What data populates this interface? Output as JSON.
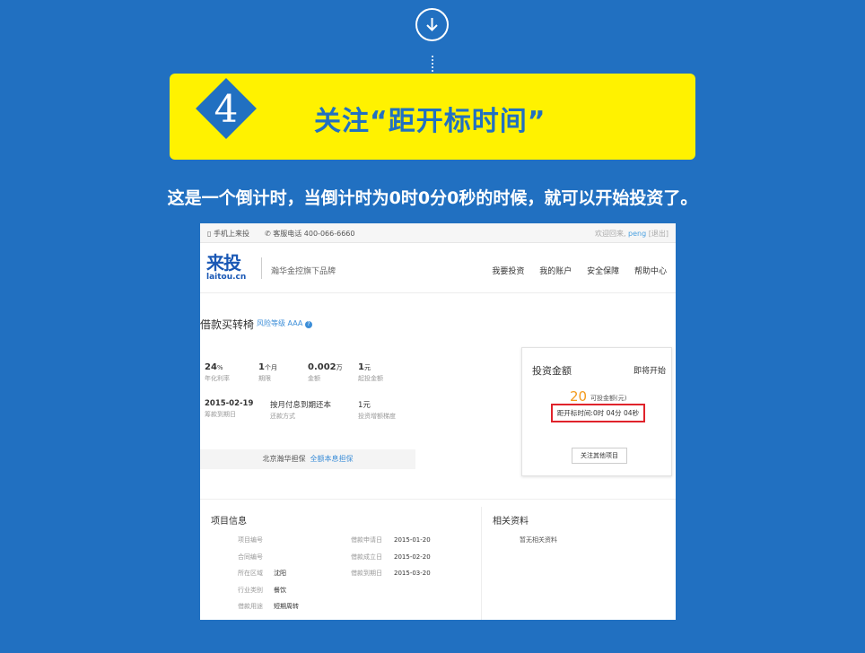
{
  "step": {
    "number": "4",
    "title": "关注“距开标时间”"
  },
  "subtitle": "这是一个倒计时，当倒计时为0时0分0秒的时候，就可以开始投资了。",
  "screenshot": {
    "topbar": {
      "mobile": "手机上来投",
      "hotline": "客服电话 400-066-6660",
      "welcome": "欢迎回来,",
      "username": "peng",
      "logout": "[退出]"
    },
    "logo": {
      "cn": "来投",
      "en": "laitou.cn"
    },
    "slogan": "瀚华金控旗下品牌",
    "nav": [
      "我要投资",
      "我的账户",
      "安全保障",
      "帮助中心"
    ],
    "loan": {
      "title": "借款买转椅",
      "risk_label": "风险等级 AAA",
      "metrics": [
        {
          "value": "24",
          "unit": "%",
          "label": "年化利率"
        },
        {
          "value": "1",
          "unit": "个月",
          "label": "期限"
        },
        {
          "value": "0.002",
          "unit": "万",
          "label": "金额"
        },
        {
          "value": "1",
          "unit": "元",
          "label": "起投金额"
        },
        {
          "value": "2015-02-19",
          "unit": "",
          "label": "筹款到期日"
        },
        {
          "value": "按月付息到期还本",
          "unit": "",
          "label": "还款方式"
        },
        {
          "value": "1",
          "unit": "元",
          "label": "投资增额梯度"
        }
      ],
      "guarantee_org": "北京瀚华担保",
      "guarantee_type": "全额本息担保"
    },
    "invest_box": {
      "title": "投资金额",
      "status": "即将开始",
      "amount": "20",
      "amount_label": "可投金额(元)",
      "countdown": "距开标时间:0时 04分 04秒",
      "follow_button": "关注其他项目"
    },
    "project_info": {
      "title": "项目信息",
      "left_fields": [
        {
          "key": "项目编号",
          "value": ""
        },
        {
          "key": "合同编号",
          "value": ""
        },
        {
          "key": "所在区域",
          "value": "沈阳"
        },
        {
          "key": "行业类别",
          "value": "餐饮"
        },
        {
          "key": "借款用途",
          "value": "短期周转"
        }
      ],
      "right_fields": [
        {
          "key": "借款申请日",
          "value": "2015-01-20"
        },
        {
          "key": "借款成立日",
          "value": "2015-02-20"
        },
        {
          "key": "借款到期日",
          "value": "2015-03-20"
        }
      ]
    },
    "related": {
      "title": "相关资料",
      "empty": "暂无相关资料"
    }
  },
  "colors": {
    "background": "#2170c1",
    "banner": "#fff200",
    "highlight_border": "#e0232b",
    "amount": "#f39a1c"
  },
  "icons": [
    "arrow-down-circle-icon",
    "phone-icon",
    "headset-icon",
    "question-icon"
  ]
}
